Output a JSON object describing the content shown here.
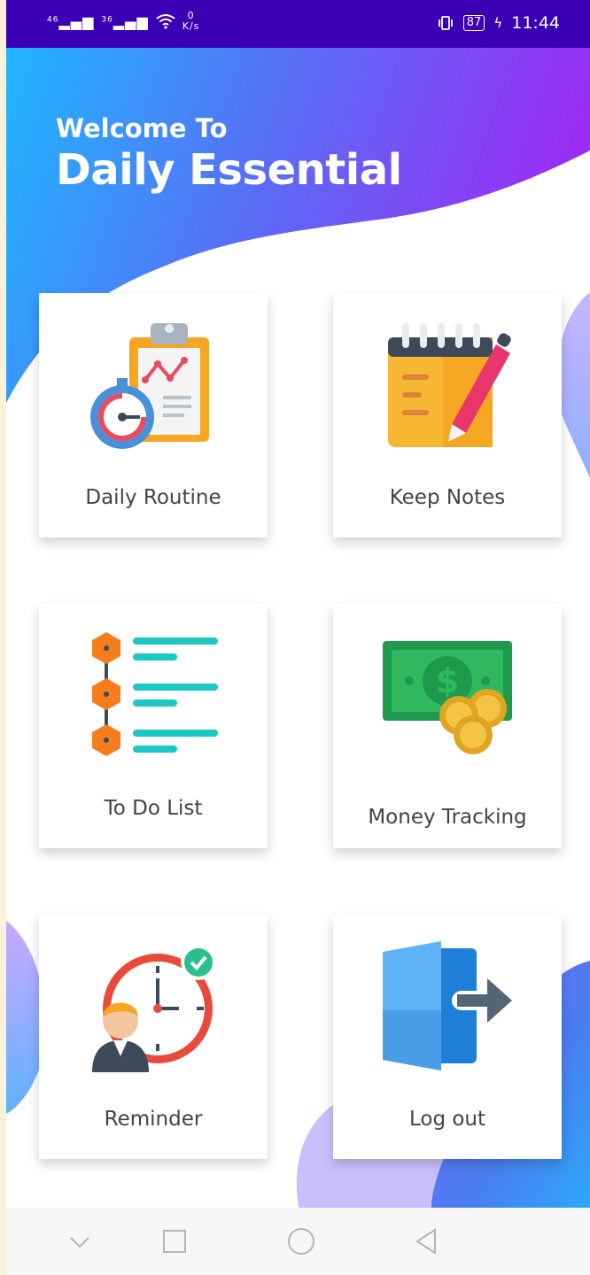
{
  "status_bar": {
    "signal_1": "46",
    "signal_2": "36",
    "net_speed_value": "0",
    "net_speed_unit": "K/s",
    "battery": "87",
    "time": "11:44"
  },
  "hero": {
    "subtitle": "Welcome To",
    "title": "Daily Essential"
  },
  "menu": [
    {
      "label": "Daily Routine",
      "icon": "clipboard-stopwatch-icon"
    },
    {
      "label": "Keep Notes",
      "icon": "notepad-pen-icon"
    },
    {
      "label": "To Do List",
      "icon": "checklist-icon"
    },
    {
      "label": "Money Tracking",
      "icon": "banknote-coins-icon"
    },
    {
      "label": "Reminder",
      "icon": "alarm-clock-person-icon"
    },
    {
      "label": "Log out",
      "icon": "exit-door-icon"
    }
  ],
  "nav_bar": {
    "icons": [
      "chevron-down-icon",
      "square-recents-icon",
      "circle-home-icon",
      "triangle-back-icon"
    ]
  },
  "colors": {
    "status_bar": "#3b00b3",
    "gradient_start": "#20b7ff",
    "gradient_mid": "#5a6cf5",
    "gradient_end": "#9b2cf3",
    "label_text": "#444444"
  }
}
